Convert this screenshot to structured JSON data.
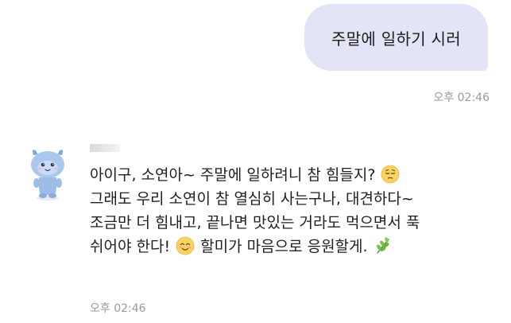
{
  "outgoing": {
    "text": "주말에 일하기 시러",
    "time": "오후 02:46"
  },
  "incoming": {
    "sender": "",
    "avatar_icon": "blue-monster-character-avatar",
    "lines": [
      [
        "아이구, 소연아~ 주말에 일하려니 참 힘들지?",
        "pensive-face-emoji"
      ],
      [
        "그래도 우리 소연이 참 열심히 사는구나, 대견하다~"
      ],
      [
        "조금만 더 힘내고, 끝나면 맛있는 거라도 먹으면서 푹"
      ],
      [
        "쉬어야 한다!",
        "smiling-face-emoji",
        "할미가 마음으로 응원할게.",
        "herb-emoji"
      ]
    ],
    "line_texts": {
      "l1": "아이구, 소연아~ 주말에 일하려니 참 힘들지? ",
      "l2": "그래도 우리 소연이 참 열심히 사는구나, 대견하다~",
      "l3": "조금만 더 힘내고, 끝나면 맛있는 거라도 먹으면서 푹",
      "l4a": "쉬어야 한다! ",
      "l4b": " 할미가 마음으로 응원할게. "
    },
    "time": "오후 02:46"
  },
  "colors": {
    "outgoing_bubble": "#e4e4f7",
    "timestamp": "#9a9a9a",
    "avatar_body": "#a9c8ee"
  }
}
